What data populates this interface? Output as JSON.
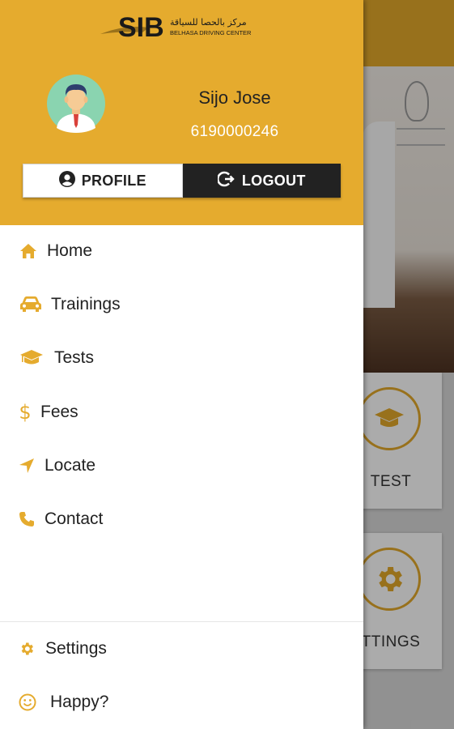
{
  "brand": {
    "logo_text": "SIB",
    "logo_arabic": "مركز بالحصا للسياقة",
    "logo_english": "BELHASA DRIVING CENTER"
  },
  "user": {
    "name": "Sijo Jose",
    "phone": "6190000246"
  },
  "buttons": {
    "profile": "PROFILE",
    "logout": "LOGOUT"
  },
  "menu": {
    "items": [
      {
        "label": "Home",
        "icon": "home-icon"
      },
      {
        "label": "Trainings",
        "icon": "car-icon"
      },
      {
        "label": "Tests",
        "icon": "graduation-cap-icon"
      },
      {
        "label": "Fees",
        "icon": "dollar-icon"
      },
      {
        "label": "Locate",
        "icon": "location-arrow-icon"
      },
      {
        "label": "Contact",
        "icon": "phone-icon"
      }
    ],
    "footer_items": [
      {
        "label": "Settings",
        "icon": "gear-icon"
      },
      {
        "label": "Happy?",
        "icon": "smiley-icon"
      }
    ]
  },
  "background": {
    "cards": [
      {
        "label": "TEST",
        "icon": "graduation-cap-icon"
      },
      {
        "label": "TTINGS",
        "icon": "gear-icon"
      }
    ]
  },
  "colors": {
    "accent": "#e5ab2e",
    "dark": "#222222",
    "white": "#ffffff"
  }
}
